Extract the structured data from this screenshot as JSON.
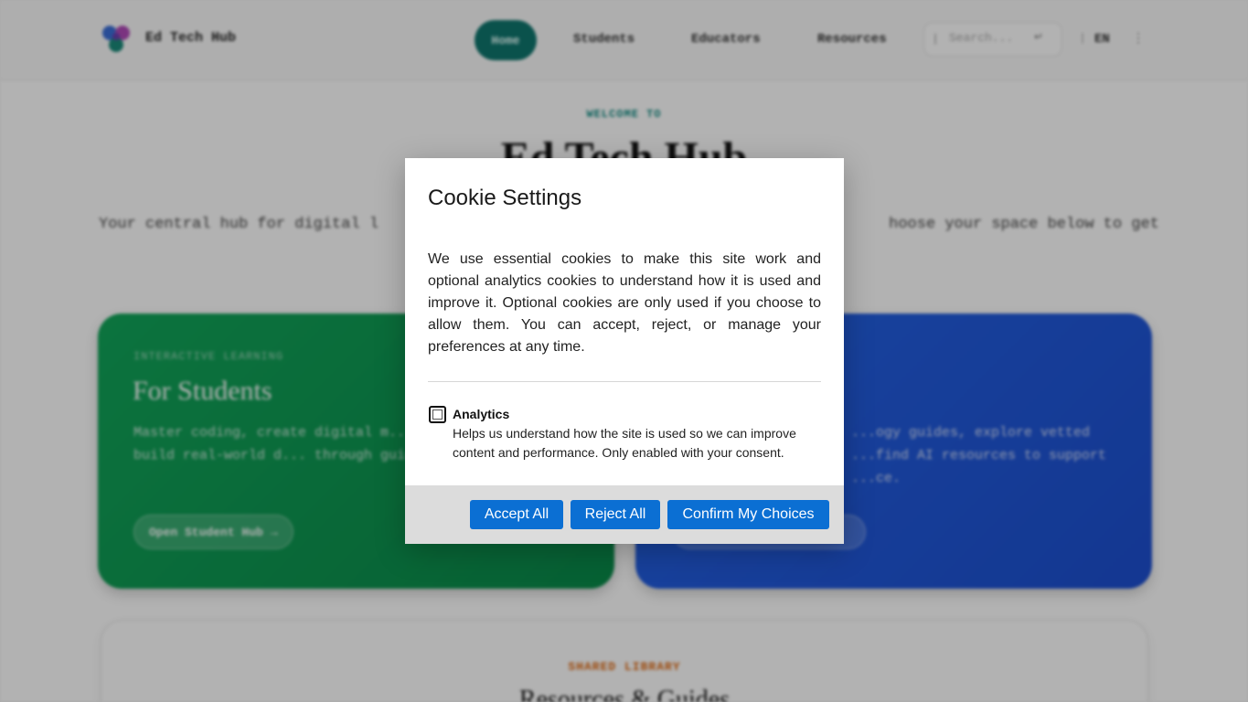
{
  "header": {
    "brand": "Ed Tech Hub",
    "nav": [
      "Home",
      "Students",
      "Educators",
      "Resources"
    ],
    "search_placeholder": "Search...",
    "search_icon": "search-icon",
    "search_submit": "↵",
    "language": "EN",
    "accent_color": "#0f766e"
  },
  "hero": {
    "eyebrow": "WELCOME TO",
    "title": "Ed Tech Hub",
    "subtitle_left": "Your central hub for digital l",
    "subtitle_right": "hoose your space below to get"
  },
  "cards": {
    "students": {
      "eyebrow": "INTERACTIVE LEARNING",
      "title": "For Students",
      "text": "Master coding, create digital m... safety, and build real-world d... through guided challenges.",
      "button": "Open Student Hub",
      "button_icon": "arrow-right-icon",
      "color": "#12a65a"
    },
    "educators": {
      "text": "...ogy guides, explore vetted ...find AI resources to support ...ce.",
      "color": "#2463e6"
    }
  },
  "library": {
    "eyebrow": "SHARED LIBRARY",
    "title": "Resources & Guides",
    "eyebrow_color": "#e06a12"
  },
  "cookie_modal": {
    "title": "Cookie Settings",
    "body": "We use essential cookies to make this site work and optional analytics cookies to understand how it is used and improve it. Optional cookies are only used if you choose to allow them. You can accept, reject, or manage your preferences at any time.",
    "option": {
      "label": "Analytics",
      "description": "Helps us understand how the site is used so we can improve content and performance. Only enabled with your consent.",
      "checked": false
    },
    "buttons": {
      "accept": "Accept All",
      "reject": "Reject All",
      "confirm": "Confirm My Choices"
    },
    "button_color": "#0b6fd3"
  }
}
